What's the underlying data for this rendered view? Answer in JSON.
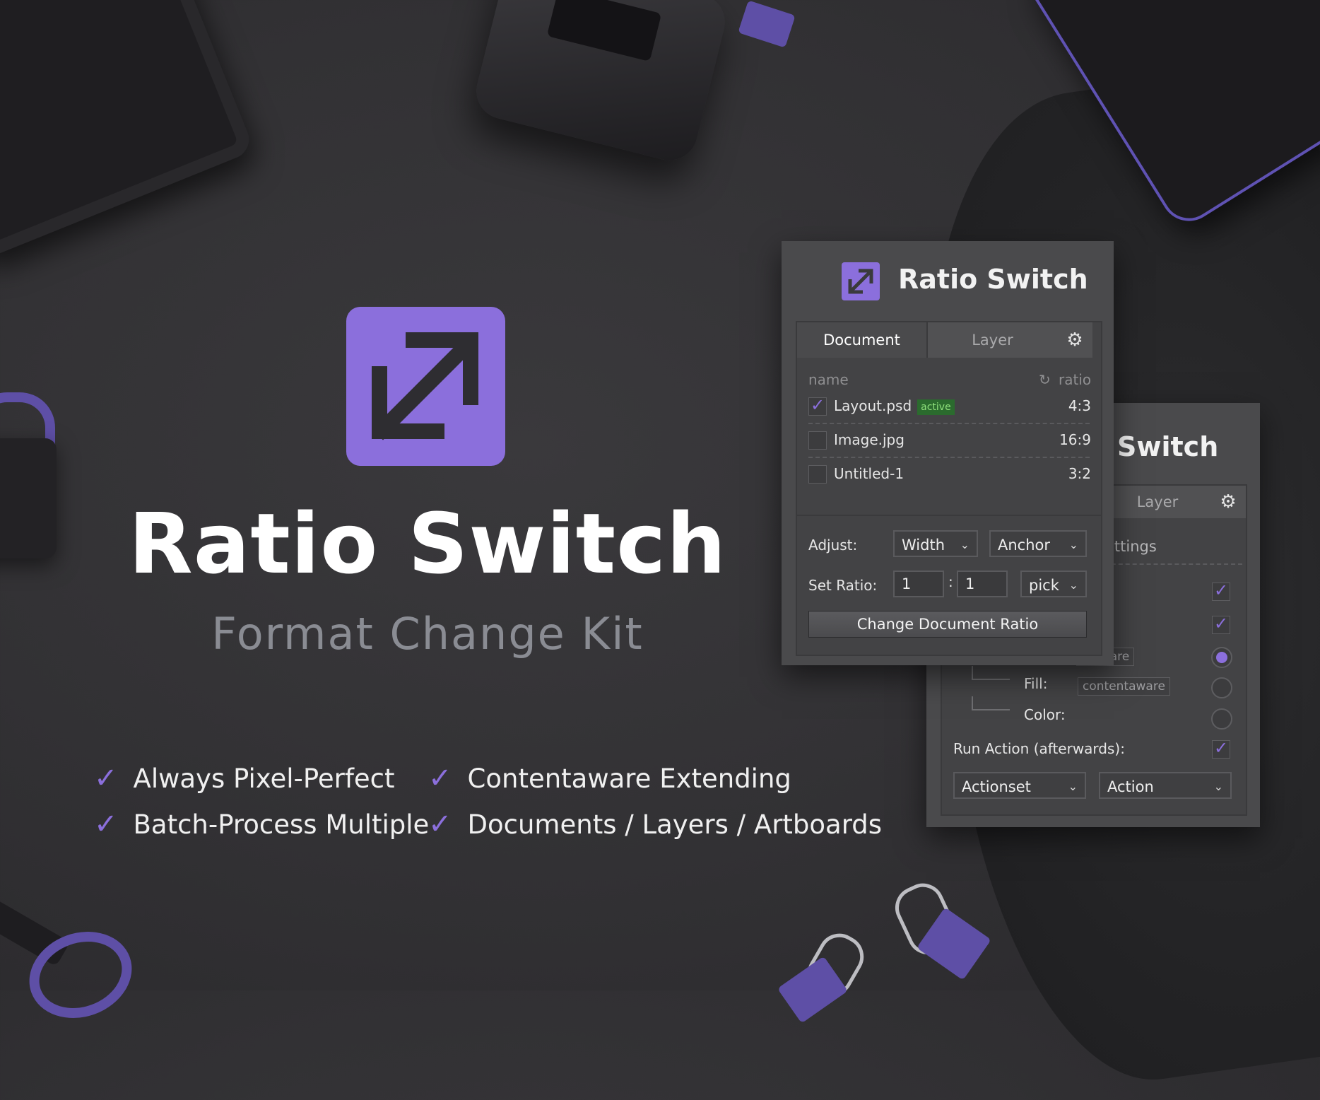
{
  "hero": {
    "title": "Ratio Switch",
    "subtitle": "Format Change Kit",
    "icon": "diagonal-resize-arrows-icon",
    "accent_color": "#8b6fdc"
  },
  "features": [
    "Always Pixel-Perfect",
    "Batch-Process Multiple",
    "Contentaware Extending",
    "Documents / Layers / Artboards"
  ],
  "front_panel": {
    "title": "Ratio Switch",
    "tabs": [
      "Document",
      "Layer"
    ],
    "active_tab": "Document",
    "list_header": {
      "name": "name",
      "ratio": "ratio"
    },
    "documents": [
      {
        "name": "Layout.psd",
        "badge": "active",
        "ratio": "4:3",
        "checked": true
      },
      {
        "name": "Image.jpg",
        "badge": "",
        "ratio": "16:9",
        "checked": false
      },
      {
        "name": "Untitled-1",
        "badge": "",
        "ratio": "3:2",
        "checked": false
      }
    ],
    "adjust_label": "Adjust:",
    "adjust_value": "Width",
    "anchor_value": "Anchor",
    "set_ratio_label": "Set Ratio:",
    "ratio_a": "1",
    "ratio_separator": ":",
    "ratio_b": "1",
    "pick_value": "pick",
    "button_label": "Change Document Ratio"
  },
  "back_panel": {
    "title_visible": "Switch",
    "tab_visible": "Layer",
    "settings_partial": "ettings",
    "fill_partial_tag": "ntaware",
    "fill_label": "Fill:",
    "fill_tag": "contentaware",
    "color_label": "Color:",
    "run_action_label": "Run Action (afterwards):",
    "actionset_value": "Actionset",
    "action_value": "Action"
  }
}
